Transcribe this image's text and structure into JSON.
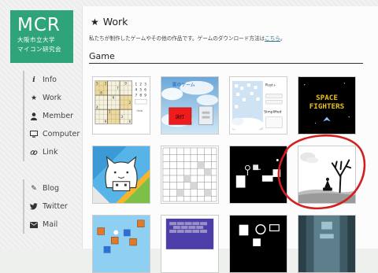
{
  "logo": {
    "mark": "MCR",
    "sub1": "大阪市立大学",
    "sub2": "マイコン研究会"
  },
  "nav": {
    "main": [
      {
        "icon": "info-icon",
        "glyph": "i",
        "label": "Info"
      },
      {
        "icon": "star-icon",
        "glyph": "★",
        "label": "Work"
      },
      {
        "icon": "person-icon",
        "glyph": "●",
        "label": "Member"
      },
      {
        "icon": "monitor-icon",
        "glyph": "▭",
        "label": "Computer"
      },
      {
        "icon": "link-icon",
        "glyph": "⊘",
        "label": "Link"
      }
    ],
    "social": [
      {
        "icon": "pencil-icon",
        "glyph": "✎",
        "label": "Blog"
      },
      {
        "icon": "twitter-icon",
        "glyph": "◆",
        "label": "Twitter"
      },
      {
        "icon": "mail-icon",
        "glyph": "✉",
        "label": "Mail"
      }
    ]
  },
  "page": {
    "title": "Work",
    "description": "私たちが制作したゲームやその他の作品です。ゲームのダウンロード方法は",
    "description_link": "こちら",
    "description_end": "。",
    "section": "Game"
  },
  "tiles": {
    "sudoku_digits": [
      "1",
      "2",
      "3",
      "4",
      "5",
      "6",
      "7",
      "8",
      "9"
    ],
    "sudoku_button": "Hello",
    "cloud_title": "雲のゲーム",
    "cloud_button": "決打",
    "sim_label": "Playt+",
    "sim_title": "Simplified",
    "space_line1": "SPACE",
    "space_line2": "FIGHTERS"
  },
  "colors": {
    "accent": "#2fa37a",
    "annotation": "#d21f1f"
  }
}
